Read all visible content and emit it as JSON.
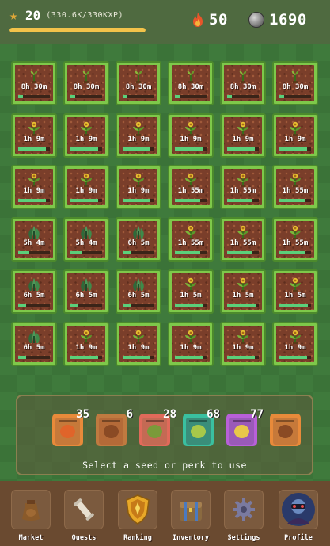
{
  "header": {
    "level": "20",
    "xp_text": "(330.6K/330KXP)",
    "xp_fraction": 1.0,
    "streak": "50",
    "coins": "1690",
    "icons": [
      "star-icon",
      "flame-icon",
      "coin-icon"
    ]
  },
  "plots": [
    [
      {
        "time": "8h 30m",
        "stage": "sprout",
        "progress": 0.15
      },
      {
        "time": "8h 30m",
        "stage": "sprout",
        "progress": 0.15
      },
      {
        "time": "8h 30m",
        "stage": "sprout",
        "progress": 0.15
      },
      {
        "time": "8h 30m",
        "stage": "sprout",
        "progress": 0.15
      },
      {
        "time": "8h 30m",
        "stage": "sprout",
        "progress": 0.15
      },
      {
        "time": "8h 30m",
        "stage": "sprout",
        "progress": 0.15
      }
    ],
    [
      {
        "time": "1h 9m",
        "stage": "flower",
        "progress": 0.88
      },
      {
        "time": "1h 9m",
        "stage": "flower",
        "progress": 0.88
      },
      {
        "time": "1h 9m",
        "stage": "flower",
        "progress": 0.88
      },
      {
        "time": "1h 9m",
        "stage": "flower",
        "progress": 0.88
      },
      {
        "time": "1h 9m",
        "stage": "flower",
        "progress": 0.88
      },
      {
        "time": "1h 9m",
        "stage": "flower",
        "progress": 0.88
      }
    ],
    [
      {
        "time": "1h 9m",
        "stage": "flower",
        "progress": 0.88
      },
      {
        "time": "1h 9m",
        "stage": "flower",
        "progress": 0.88
      },
      {
        "time": "1h 9m",
        "stage": "flower",
        "progress": 0.88
      },
      {
        "time": "1h 55m",
        "stage": "flower",
        "progress": 0.8
      },
      {
        "time": "1h 55m",
        "stage": "flower",
        "progress": 0.8
      },
      {
        "time": "1h 55m",
        "stage": "flower",
        "progress": 0.8
      }
    ],
    [
      {
        "time": "5h 4m",
        "stage": "leafy",
        "progress": 0.35
      },
      {
        "time": "5h 4m",
        "stage": "leafy",
        "progress": 0.35
      },
      {
        "time": "6h 5m",
        "stage": "leafy",
        "progress": 0.25
      },
      {
        "time": "1h 55m",
        "stage": "flower",
        "progress": 0.8
      },
      {
        "time": "1h 55m",
        "stage": "flower",
        "progress": 0.8
      },
      {
        "time": "1h 55m",
        "stage": "flower",
        "progress": 0.8
      }
    ],
    [
      {
        "time": "6h 5m",
        "stage": "leafy",
        "progress": 0.25
      },
      {
        "time": "6h 5m",
        "stage": "leafy",
        "progress": 0.25
      },
      {
        "time": "6h 5m",
        "stage": "leafy",
        "progress": 0.25
      },
      {
        "time": "1h 5m",
        "stage": "flower",
        "progress": 0.9
      },
      {
        "time": "1h 5m",
        "stage": "flower",
        "progress": 0.9
      },
      {
        "time": "1h 5m",
        "stage": "flower",
        "progress": 0.9
      }
    ],
    [
      {
        "time": "6h 5m",
        "stage": "leafy",
        "progress": 0.25
      },
      {
        "time": "1h 9m",
        "stage": "flower",
        "progress": 0.88
      },
      {
        "time": "1h 9m",
        "stage": "flower",
        "progress": 0.88
      },
      {
        "time": "1h 9m",
        "stage": "flower",
        "progress": 0.88
      },
      {
        "time": "1h 9m",
        "stage": "flower",
        "progress": 0.88
      },
      {
        "time": "1h 9m",
        "stage": "flower",
        "progress": 0.88
      }
    ]
  ],
  "seeds": [
    {
      "count": "35",
      "border": "#e88a3a",
      "pack": "#c6793a",
      "pic": "#e0642a"
    },
    {
      "count": "6",
      "border": "#c07a40",
      "pack": "#b46a38",
      "pic": "#8a4a24"
    },
    {
      "count": "28",
      "border": "#e06a5a",
      "pack": "#c46a54",
      "pic": "#7a9a3a"
    },
    {
      "count": "68",
      "border": "#3ac0a0",
      "pack": "#3a8e7a",
      "pic": "#a8c84a"
    },
    {
      "count": "77",
      "border": "#b860d8",
      "pack": "#9a5ab8",
      "pic": "#e8c84a"
    },
    {
      "count": "",
      "border": "#e88a3a",
      "pack": "#c6793a",
      "pic": "#8a4a24"
    }
  ],
  "hint": "Select a seed or perk to use",
  "nav": [
    {
      "label": "Market",
      "icon": "seed-bag-icon"
    },
    {
      "label": "Quests",
      "icon": "scroll-icon"
    },
    {
      "label": "Ranking",
      "icon": "trophy-shield-icon"
    },
    {
      "label": "Inventory",
      "icon": "chest-icon"
    },
    {
      "label": "Settings",
      "icon": "gear-icon"
    },
    {
      "label": "Profile",
      "icon": "avatar-icon"
    }
  ]
}
